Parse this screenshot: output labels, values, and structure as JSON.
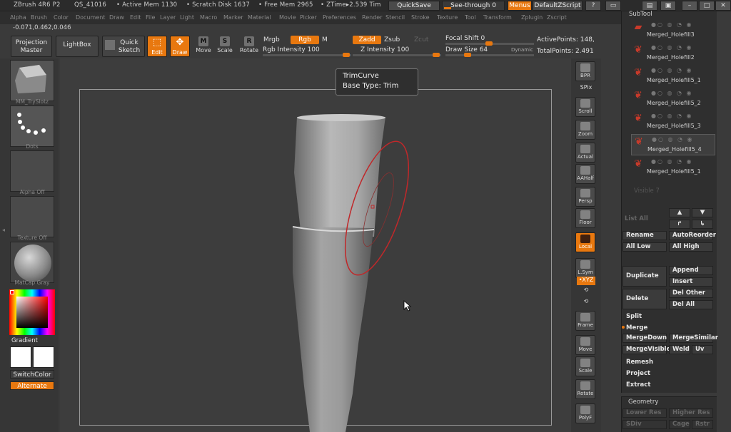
{
  "titlebar": {
    "app": "ZBrush 4R6 P2",
    "qs": "QS_41016",
    "active_mem": "• Active Mem 1130",
    "scratch": "• Scratch Disk 1637",
    "free_mem": "• Free Mem 2965",
    "ztime": "• ZTime▸2.539 Tim",
    "quicksave": "QuickSave",
    "seethrough": "See-through",
    "seethrough_value": "0",
    "menus": "Menus",
    "script": "DefaultZScript"
  },
  "menus": [
    "Alpha",
    "Brush",
    "Color",
    "Document",
    "Draw",
    "Edit",
    "File",
    "Layer",
    "Light",
    "Macro",
    "Marker",
    "Material",
    "Movie",
    "Picker",
    "Preferences",
    "Render",
    "Stencil",
    "Stroke",
    "Texture",
    "Tool",
    "Transform",
    "Zplugin",
    "Zscript"
  ],
  "coords": "-0.071,0.462,0.046",
  "toolbar": {
    "projection_master": [
      "Projection",
      "Master"
    ],
    "lightbox": "LightBox",
    "quick_sketch": [
      "Quick",
      "Sketch"
    ],
    "edit": "Edit",
    "draw": "Draw",
    "move": "Move",
    "scale": "Scale",
    "rotate": "Rotate",
    "mrgb": "Mrgb",
    "rgb": "Rgb",
    "m": "M",
    "rgb_intensity": "Rgb Intensity 100",
    "zadd": "Zadd",
    "zsub": "Zsub",
    "zcut": "Zcut",
    "z_intensity": "Z Intensity 100",
    "focal_shift": "Focal Shift 0",
    "draw_size": "Draw Size 64",
    "dynamic": "Dynamic",
    "active_points": "ActivePoints: 148,",
    "total_points": "TotalPoints: 2.491"
  },
  "left": {
    "brush_label": "MM_TrySlotz",
    "dots": "Dots",
    "alpha": "Alpha Off",
    "texture": "Texture Off",
    "material": "MatCap Gray",
    "gradient": "Gradient",
    "switchcolor": "SwitchColor",
    "alternate": "Alternate"
  },
  "tooltip": {
    "title": "TrimCurve",
    "subtitle": "Base Type: Trim"
  },
  "right_tools": [
    "BPR",
    "SPix",
    "Scroll",
    "Zoom",
    "Actual",
    "AAHalf",
    "Persp",
    "Floor",
    "Local",
    "L.Sym",
    "•XYZ",
    "",
    "",
    "Frame",
    "Move",
    "Scale",
    "Rotate",
    "PolyF"
  ],
  "subtool": {
    "header": "SubTool",
    "items": [
      "Merged_Holefill3",
      "Merged_Holefill2",
      "Merged_Holefill5_1",
      "Merged_Holefill5_2",
      "Merged_Holefill5_3",
      "Merged_Holefill5_4",
      "Merged_Holefill5_1"
    ],
    "visible": "Visible 7",
    "list_all": "List All",
    "rename": "Rename",
    "auto_reorder": "AutoReorder",
    "all_low": "All Low",
    "all_high": "All High",
    "duplicate": "Duplicate",
    "append": "Append",
    "insert": "Insert",
    "delete": "Delete",
    "del_other": "Del Other",
    "del_all": "Del All",
    "split": "Split",
    "merge": "Merge",
    "merge_down": "MergeDown",
    "merge_similar": "MergeSimilar",
    "merge_visible": "MergeVisible",
    "weld": "Weld",
    "uv": "Uv",
    "remesh": "Remesh",
    "project": "Project",
    "extract": "Extract"
  },
  "geometry": {
    "header": "Geometry",
    "lower_res": "Lower Res",
    "higher_res": "Higher Res",
    "sdiv": "SDiv",
    "cage": "Cage",
    "rstr": "Rstr"
  }
}
